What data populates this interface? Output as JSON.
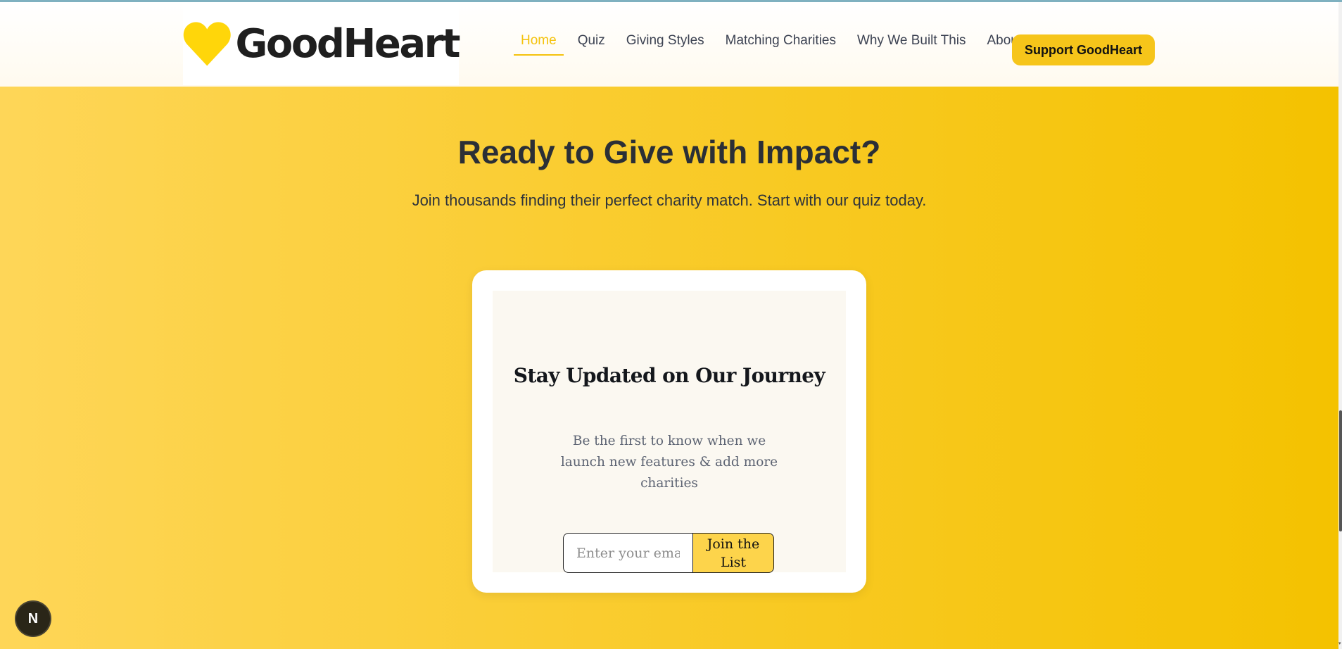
{
  "header": {
    "logo_text": "GoodHeart",
    "nav": [
      {
        "label": "Home",
        "active": true
      },
      {
        "label": "Quiz",
        "active": false
      },
      {
        "label": "Giving Styles",
        "active": false
      },
      {
        "label": "Matching Charities",
        "active": false
      },
      {
        "label": "Why We Built This",
        "active": false
      },
      {
        "label": "About",
        "active": false
      }
    ],
    "cta_label": "Support GoodHeart"
  },
  "hero": {
    "title": "Ready to Give with Impact?",
    "subtitle": "Join thousands finding their perfect charity match. Start with our quiz today."
  },
  "newsletter": {
    "title": "Stay Updated on Our Journey",
    "description": "Be the first to know when we launch new features & add more charities",
    "email_placeholder": "Enter your email",
    "email_value": "",
    "button_label": "Join the List"
  },
  "badge": {
    "letter": "N"
  },
  "colors": {
    "brand_yellow": "#f6c51a",
    "heart": "#ffd60a",
    "active_nav": "#f4c20d",
    "text_dark": "#2b2f36"
  },
  "icons": {
    "logo": "heart-icon",
    "badge": "n-logo-icon"
  }
}
